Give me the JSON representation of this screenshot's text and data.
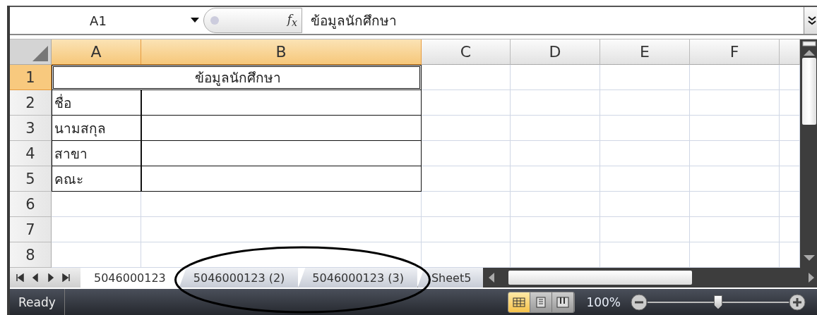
{
  "formula_bar": {
    "name_box": "A1",
    "function_label": "f$_{x}$",
    "content": "ข้อมูลนักศึกษา"
  },
  "columns": [
    {
      "label": "A",
      "selected": true
    },
    {
      "label": "B",
      "selected": true
    },
    {
      "label": "C",
      "selected": false
    },
    {
      "label": "D",
      "selected": false
    },
    {
      "label": "E",
      "selected": false
    },
    {
      "label": "F",
      "selected": false
    }
  ],
  "rows": [
    {
      "header": "1",
      "selected": true,
      "cells": [
        {
          "text": "ข้อมูลนักศึกษา",
          "merged": true,
          "selected": true
        }
      ]
    },
    {
      "header": "2",
      "selected": false,
      "cells": [
        {
          "text": "ชื่อ"
        }
      ]
    },
    {
      "header": "3",
      "selected": false,
      "cells": [
        {
          "text": "นามสกุล"
        }
      ]
    },
    {
      "header": "4",
      "selected": false,
      "cells": [
        {
          "text": "สาขา"
        }
      ]
    },
    {
      "header": "5",
      "selected": false,
      "cells": [
        {
          "text": "คณะ"
        }
      ]
    },
    {
      "header": "6",
      "selected": false,
      "cells": []
    },
    {
      "header": "7",
      "selected": false,
      "cells": []
    },
    {
      "header": "8",
      "selected": false,
      "cells": []
    }
  ],
  "sheet_tabs": [
    {
      "label": "5046000123",
      "selected": true
    },
    {
      "label": "5046000123 (2)",
      "selected": false
    },
    {
      "label": "5046000123 (3)",
      "selected": false
    },
    {
      "label": "Sheet5",
      "selected": false
    }
  ],
  "status_bar": {
    "status": "Ready",
    "views": [
      {
        "kind": "normal",
        "selected": true
      },
      {
        "kind": "layout",
        "selected": false
      },
      {
        "kind": "break",
        "selected": false
      }
    ],
    "zoom": "100%",
    "zoom_level": {
      "level": 0.5
    }
  }
}
